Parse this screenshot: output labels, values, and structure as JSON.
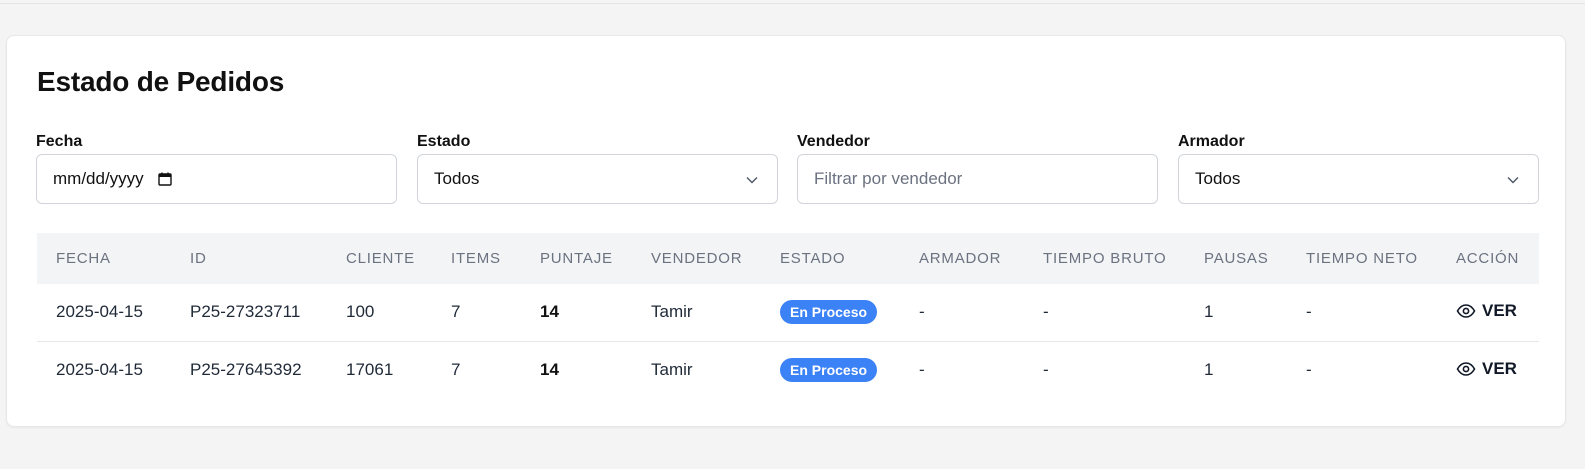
{
  "page": {
    "title": "Estado de Pedidos"
  },
  "filters": {
    "fecha": {
      "label": "Fecha",
      "value": "mm/dd/yyyy"
    },
    "estado": {
      "label": "Estado",
      "value": "Todos"
    },
    "vendedor": {
      "label": "Vendedor",
      "placeholder": "Filtrar por vendedor"
    },
    "armador": {
      "label": "Armador",
      "value": "Todos"
    }
  },
  "table": {
    "columns": [
      "FECHA",
      "ID",
      "CLIENTE",
      "ITEMS",
      "PUNTAJE",
      "VENDEDOR",
      "ESTADO",
      "ARMADOR",
      "TIEMPO BRUTO",
      "PAUSAS",
      "TIEMPO NETO",
      "ACCIÓN"
    ],
    "rows": [
      {
        "fecha": "2025-04-15",
        "id": "P25-27323711",
        "cliente": "100",
        "items": "7",
        "puntaje": "14",
        "vendedor": "Tamir",
        "estado": "En Proceso",
        "armador": "-",
        "tiempo_bruto": "-",
        "pausas": "1",
        "tiempo_neto": "-",
        "accion": "VER"
      },
      {
        "fecha": "2025-04-15",
        "id": "P25-27645392",
        "cliente": "17061",
        "items": "7",
        "puntaje": "14",
        "vendedor": "Tamir",
        "estado": "En Proceso",
        "armador": "-",
        "tiempo_bruto": "-",
        "pausas": "1",
        "tiempo_neto": "-",
        "accion": "VER"
      }
    ]
  },
  "colors": {
    "status_badge": "#3b82f6",
    "page_background": "#f4f4f4",
    "header_row": "#f3f4f6"
  },
  "icons": {
    "calendar": "calendar-icon",
    "chevron": "chevron-down-icon",
    "eye": "eye-icon"
  }
}
